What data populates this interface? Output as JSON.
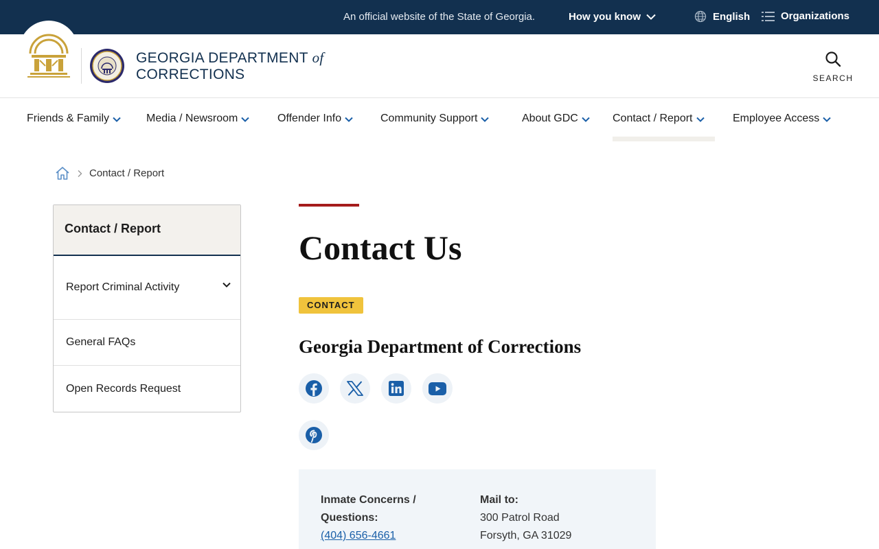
{
  "topbar": {
    "official_text": "An official website of the State of Georgia.",
    "how_you_know": "How you know",
    "language": "English",
    "organizations": "Organizations"
  },
  "header": {
    "title_line1": "GEORGIA DEPARTMENT",
    "title_of": "of",
    "title_line2": "CORRECTIONS",
    "search_label": "SEARCH"
  },
  "nav": {
    "items": [
      {
        "label": "Friends & Family"
      },
      {
        "label": "Media / Newsroom"
      },
      {
        "label": "Offender Info"
      },
      {
        "label": "Community Support"
      },
      {
        "label": "About GDC"
      },
      {
        "label": "Contact / Report"
      },
      {
        "label": "Employee Access"
      }
    ],
    "active": "Contact / Report"
  },
  "breadcrumb": {
    "current": "Contact / Report"
  },
  "sidenav": {
    "heading": "Contact / Report",
    "links": [
      {
        "label": "Report Criminal Activity"
      },
      {
        "label": "General FAQs"
      },
      {
        "label": "Open Records Request"
      }
    ]
  },
  "main": {
    "title": "Contact Us",
    "tag": "CONTACT",
    "org_name": "Georgia Department of Corrections",
    "social": [
      "facebook-icon",
      "x-icon",
      "linkedin-icon",
      "youtube-icon",
      "pinterest-icon"
    ],
    "contact": {
      "concerns_label_1": "Inmate Concerns /",
      "concerns_label_2": "Questions:",
      "concerns_phone": "(404) 656-4661",
      "mail_label": "Mail to:",
      "mail_line1": "300 Patrol Road",
      "mail_line2": "Forsyth, GA 31029"
    }
  },
  "colors": {
    "navy": "#12304f",
    "accent_red": "#a51c1c",
    "tag_yellow": "#f0c33c",
    "social_blue": "#1a5fa8",
    "gold": "#c9a23a"
  }
}
